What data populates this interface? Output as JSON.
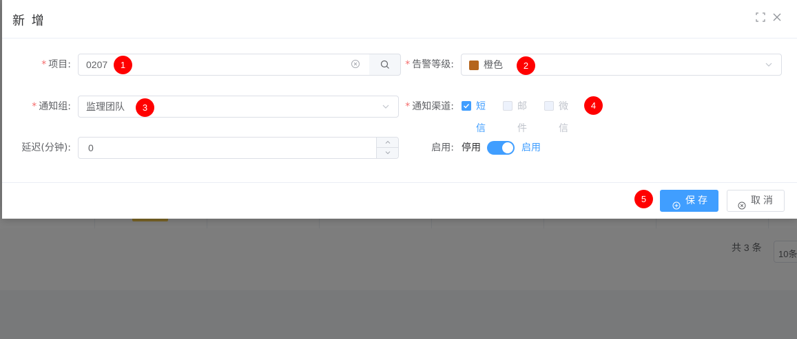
{
  "dialog": {
    "title": "新 增"
  },
  "form": {
    "project": {
      "label": "项目:",
      "value": "0207"
    },
    "alert_level": {
      "label": "告警等级:",
      "value": "橙色",
      "color": "#b5651d"
    },
    "notify_group": {
      "label": "通知组:",
      "value": "监理团队"
    },
    "notify_channel": {
      "label": "通知渠道:",
      "options": [
        {
          "label": "短信",
          "checked": true
        },
        {
          "label": "邮件",
          "checked": false
        },
        {
          "label": "微信",
          "checked": false
        }
      ]
    },
    "delay": {
      "label": "延迟(分钟):",
      "value": "0"
    },
    "enabled": {
      "label": "启用:",
      "off_label": "停用",
      "on_label": "启用",
      "on": true
    }
  },
  "footer": {
    "save_label": "保存",
    "cancel_label": "取消"
  },
  "badges": [
    "1",
    "2",
    "3",
    "4",
    "5"
  ],
  "background": {
    "pager_total": "共 3 条",
    "page_size": "10条"
  },
  "colors": {
    "primary": "#409eff",
    "required": "#f56c6c",
    "badge": "#ff0000"
  }
}
